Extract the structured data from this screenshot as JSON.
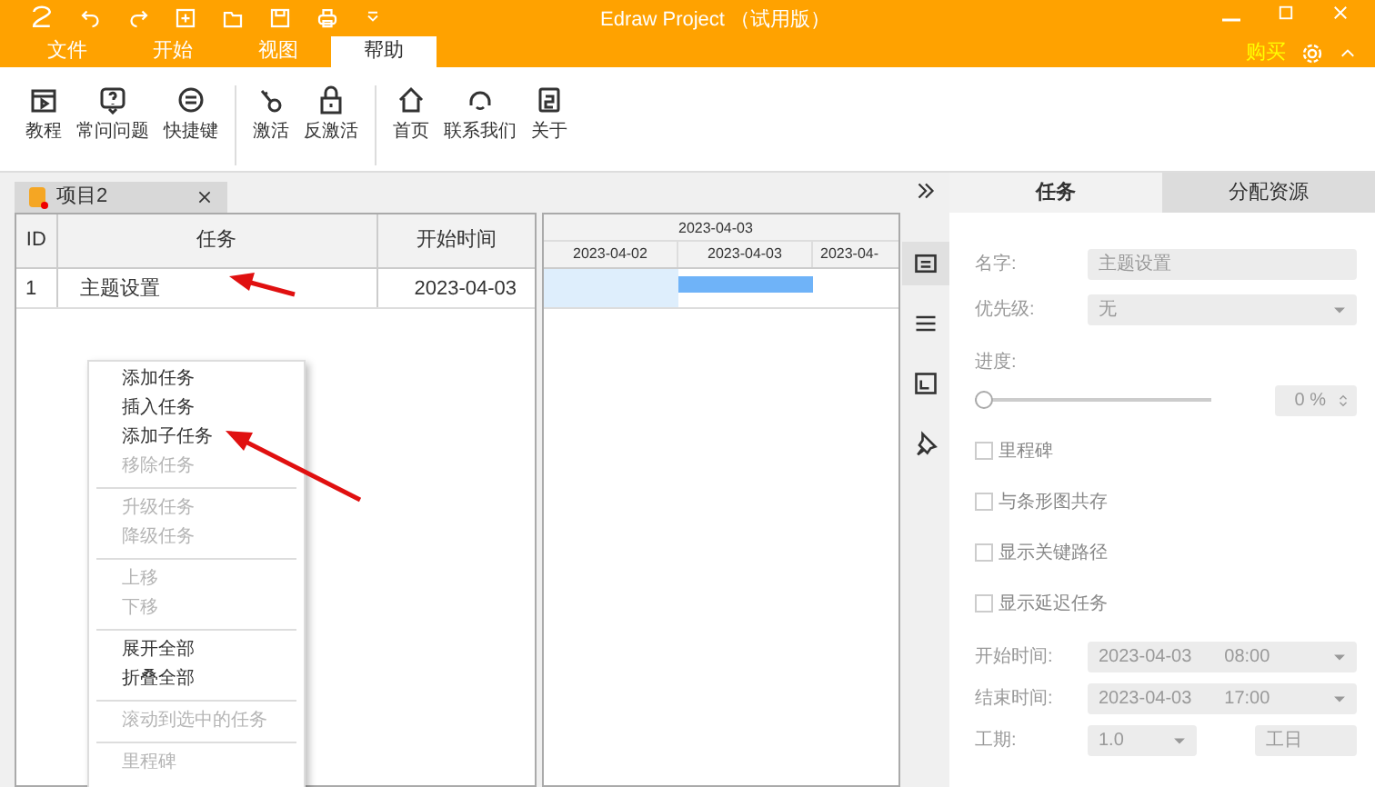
{
  "window": {
    "title": "Edraw Project （试用版）"
  },
  "menu_tabs": [
    {
      "label": "文件",
      "selected": false
    },
    {
      "label": "开始",
      "selected": false
    },
    {
      "label": "视图",
      "selected": false
    },
    {
      "label": "帮助",
      "selected": true
    }
  ],
  "buy_link": "购买",
  "ribbon_groups": [
    [
      "教程",
      "常问问题",
      "快捷键"
    ],
    [
      "激活",
      "反激活"
    ],
    [
      "首页",
      "联系我们",
      "关于"
    ]
  ],
  "document_tab": {
    "title": "项目2"
  },
  "task_table": {
    "columns": [
      "ID",
      "任务",
      "开始时间"
    ],
    "rows": [
      {
        "id": "1",
        "task": "主题设置",
        "start": "2023-04-03"
      }
    ]
  },
  "gantt": {
    "top_header": "2023-04-03",
    "dates": [
      "2023-04-02",
      "2023-04-03",
      "2023-04-"
    ]
  },
  "context_menu": [
    [
      {
        "label": "添加任务",
        "disabled": false
      },
      {
        "label": "插入任务",
        "disabled": false
      },
      {
        "label": "添加子任务",
        "disabled": false
      },
      {
        "label": "移除任务",
        "disabled": true
      }
    ],
    [
      {
        "label": "升级任务",
        "disabled": true
      },
      {
        "label": "降级任务",
        "disabled": true
      }
    ],
    [
      {
        "label": "上移",
        "disabled": true
      },
      {
        "label": "下移",
        "disabled": true
      }
    ],
    [
      {
        "label": "展开全部",
        "disabled": false
      },
      {
        "label": "折叠全部",
        "disabled": false
      }
    ],
    [
      {
        "label": "滚动到选中的任务",
        "disabled": true
      }
    ],
    [
      {
        "label": "里程碑",
        "disabled": true
      }
    ]
  ],
  "side_icons": [
    {
      "selected": true
    },
    {
      "selected": false
    },
    {
      "selected": false
    },
    {
      "selected": false
    }
  ],
  "panel_tabs": [
    {
      "label": "任务",
      "selected": true
    },
    {
      "label": "分配资源",
      "selected": false
    }
  ],
  "properties": {
    "name_label": "名字:",
    "name_value": "主题设置",
    "priority_label": "优先级:",
    "priority_value": "无",
    "progress_label": "进度:",
    "progress": {
      "level": 0
    },
    "progress_value": "0 %",
    "checkboxes": [
      {
        "label": "里程碑",
        "checked": false
      },
      {
        "label": "与条形图共存",
        "checked": false
      },
      {
        "label": "显示关键路径",
        "checked": false
      },
      {
        "label": "显示延迟任务",
        "checked": false
      }
    ],
    "start_label": "开始时间:",
    "start_date": "2023-04-03",
    "start_time": "08:00",
    "end_label": "结束时间:",
    "end_date": "2023-04-03",
    "end_time": "17:00",
    "duration_label": "工期:",
    "duration_value": "1.0",
    "duration_unit": "工日"
  }
}
